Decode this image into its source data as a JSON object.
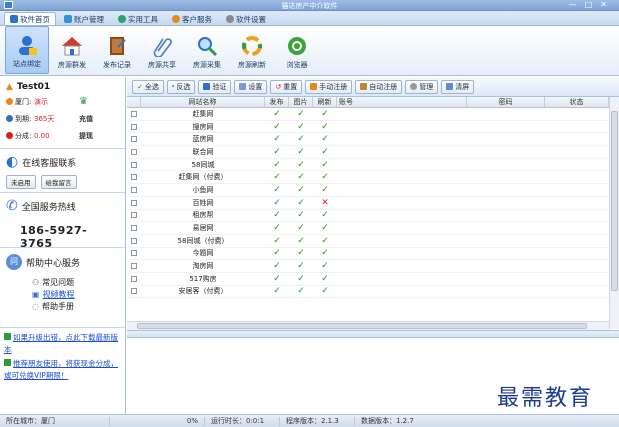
{
  "window": {
    "title": "猫达房产中介软件",
    "controls": [
      "—",
      "□",
      "✕"
    ]
  },
  "tabs": [
    {
      "label": "软件首页",
      "color": "#2f6fd0"
    },
    {
      "label": "账户管理",
      "color": "#3a8fd8"
    },
    {
      "label": "实用工具",
      "color": "#29a36a"
    },
    {
      "label": "客户服务",
      "color": "#e58a1a"
    },
    {
      "label": "软件设置",
      "color": "#8a8a8a"
    }
  ],
  "toolbar": [
    {
      "label": "站点绑定",
      "icon": "user-icon"
    },
    {
      "label": "房源群发",
      "icon": "house-icon"
    },
    {
      "label": "发布记录",
      "icon": "book-icon"
    },
    {
      "label": "房源共享",
      "icon": "paperclip-icon"
    },
    {
      "label": "房源采集",
      "icon": "magnifier-icon"
    },
    {
      "label": "房源刷新",
      "icon": "refresh-icon"
    },
    {
      "label": "浏览器",
      "icon": "browser-icon"
    }
  ],
  "account": {
    "name": "Test01",
    "rows": [
      {
        "label": "厦门:",
        "value": "演示",
        "action": ""
      },
      {
        "label": "到期:",
        "value": "365天",
        "action": "充值"
      },
      {
        "label": "分成:",
        "value": "0.00",
        "action": "提现"
      }
    ]
  },
  "service": {
    "title": "在线客服联系",
    "buttons": [
      "未启用",
      "给我留言"
    ]
  },
  "hotline": {
    "title": "全国服务热线",
    "number": "186-5927-3765"
  },
  "help": {
    "title": "帮助中心服务",
    "items": [
      {
        "label": "常见问题",
        "link": false
      },
      {
        "label": "视频教程",
        "link": true
      },
      {
        "label": "帮助手册",
        "link": false
      }
    ]
  },
  "promo": [
    "如果升级出错，点此下载最新版本",
    "推荐朋友使用，将获现金分成，或可兑换VIP期限！"
  ],
  "actions": [
    "全选",
    "反选",
    "验证",
    "设置",
    "重置",
    "手动注册",
    "自动注册",
    "管理",
    "清屏"
  ],
  "grid": {
    "headers": [
      "",
      "网站名称",
      "发布",
      "图片",
      "刷新",
      "账号",
      "密码",
      "状态"
    ],
    "rows": [
      {
        "name": "赶集网",
        "pub": true,
        "img": true,
        "ref": true
      },
      {
        "name": "搜房网",
        "pub": true,
        "img": true,
        "ref": true
      },
      {
        "name": "蓝房网",
        "pub": true,
        "img": true,
        "ref": true
      },
      {
        "name": "联合网",
        "pub": true,
        "img": true,
        "ref": true
      },
      {
        "name": "58同城",
        "pub": true,
        "img": true,
        "ref": true
      },
      {
        "name": "赶集网（付费）",
        "pub": true,
        "img": true,
        "ref": true
      },
      {
        "name": "小鱼网",
        "pub": true,
        "img": true,
        "ref": true
      },
      {
        "name": "百姓网",
        "pub": true,
        "img": true,
        "ref": false
      },
      {
        "name": "租房帮",
        "pub": true,
        "img": true,
        "ref": true
      },
      {
        "name": "易居网",
        "pub": true,
        "img": true,
        "ref": true
      },
      {
        "name": "58同城（付费）",
        "pub": true,
        "img": true,
        "ref": true
      },
      {
        "name": "今题网",
        "pub": true,
        "img": true,
        "ref": true
      },
      {
        "name": "淘房网",
        "pub": true,
        "img": true,
        "ref": true
      },
      {
        "name": "517购房",
        "pub": true,
        "img": true,
        "ref": true
      },
      {
        "name": "安居客（付费）",
        "pub": true,
        "img": true,
        "ref": true
      }
    ]
  },
  "status": [
    "所在城市：厦门",
    "0%",
    "运行时长：0:0:1",
    "程序版本：2.1.3",
    "数据版本：1.2.7"
  ],
  "watermark": "最需教育",
  "colors": {
    "accent": "#2f6fd0",
    "check": "#2b8f2b",
    "cross": "#e02020",
    "warn": "#e02020"
  }
}
